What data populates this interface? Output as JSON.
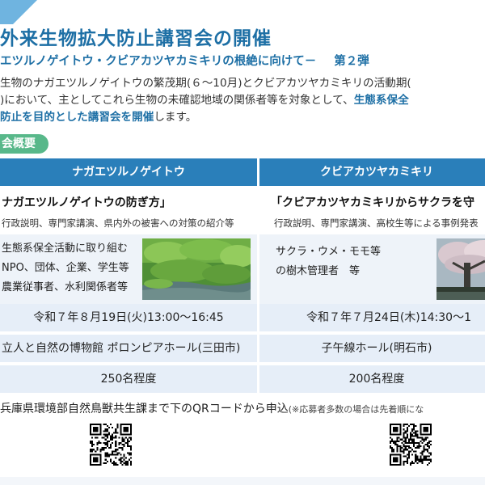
{
  "header": {
    "title": "外来生物拡大防止講習会の開催",
    "subtitle": "エツルノゲイトウ・クビアカツヤカミキリの根絶に向けて－",
    "series": "第２弾"
  },
  "intro": {
    "line1": "生物のナガエツルノゲイトウの繁茂期(６～10月)とクビアカツヤカミキリの活動期(",
    "line2a": ")において、主としてこれら生物の未確認地域の関係者等を対象として、",
    "line2b": "生態系保全",
    "line3a": "防止を目的とした講習会を開催",
    "line3b": "します。"
  },
  "section": {
    "label": "会概要"
  },
  "table": {
    "columns": [
      {
        "header": "ナガエツルノゲイトウ",
        "program_title": "ナガエツルノゲイトウの防ぎ方」",
        "program_desc": "行政説明、専門家講演、県内外の被害への対策の紹介等",
        "target_lines": [
          "生態系保全活動に取り組む",
          "NPO、団体、企業、学生等",
          "農業従事者、水利関係者等"
        ],
        "photo": "grassland-photo",
        "date": "令和７年８月19日(火)13:00～16:45",
        "venue": "立人と自然の博物館 ポロンピアホール(三田市)",
        "capacity": "250名程度"
      },
      {
        "header": "クビアカツヤカミキリ",
        "program_title": "「クビアカツヤカミキリからサクラを守",
        "program_desc": "行政説明、専門家講演、高校生等による事例発表",
        "target_lines": [
          "サクラ・ウメ・モモ等",
          "の樹木管理者　等"
        ],
        "photo": "cherry-tree-photo",
        "date": "令和７年７月24日(木)14:30～1",
        "venue": "子午線ホール(明石市)",
        "capacity": "200名程度"
      }
    ]
  },
  "application": {
    "text": "兵庫県環境部自然鳥獣共生課まで下のQRコードから申込",
    "note": "(※応募者多数の場合は先着順にな"
  },
  "colors": {
    "accent_blue": "#1d6fa5",
    "header_blue": "#2a7fba",
    "section_green": "#58b88a",
    "band_bg": "#e6eef8"
  }
}
